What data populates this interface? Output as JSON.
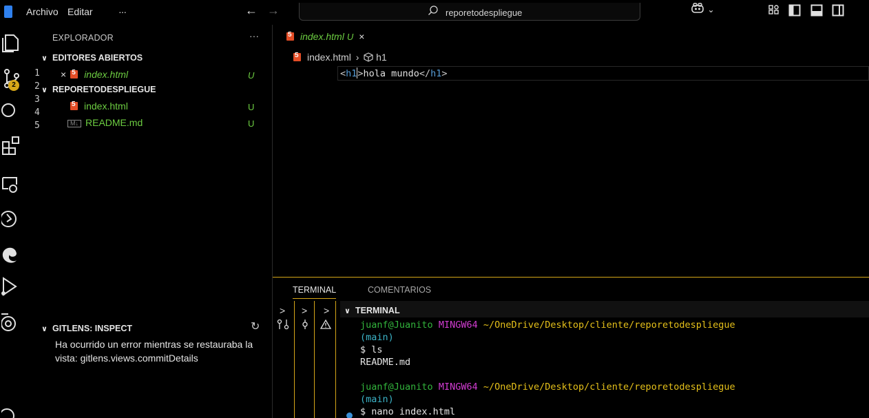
{
  "titlebar": {
    "menu": [
      "Archivo",
      "Editar",
      "···"
    ],
    "back_arrow": "←",
    "forward_arrow": "→",
    "search_text": "reporetodespliegue",
    "copilot_symbol": "⌄"
  },
  "activity": {
    "icons": [
      "explorer-icon",
      "source-control-icon",
      "search-icon",
      "extensions-icon",
      "remote-explorer-icon",
      "timeline-icon",
      "edge-icon",
      "run-debug-icon",
      "gitlens-icon",
      "account-icon"
    ],
    "badge": "2"
  },
  "sidebar": {
    "title": "EXPLORADOR",
    "dots": "···",
    "open_editors": {
      "heading": "EDITORES ABIERTOS",
      "items": [
        {
          "close": "×",
          "name": "index.html",
          "status": "U"
        }
      ]
    },
    "workspace": {
      "heading": "REPORETODESPLIEGUE",
      "files": [
        {
          "icon": "html-icon",
          "name": "index.html",
          "status": "U"
        },
        {
          "icon": "markdown-icon",
          "badge": "M↓",
          "name": "README.md",
          "status": "U"
        }
      ]
    },
    "gitlens": {
      "heading": "GITLENS: INSPECT",
      "refresh": "↻",
      "message": "Ha ocurrido un error mientras se restauraba la vista: gitlens.views.commitDetails"
    }
  },
  "editor": {
    "tab": {
      "name": "index.html",
      "status": "U",
      "close": "×"
    },
    "breadcrumb": {
      "file": "index.html",
      "sep": "›",
      "symbol": "h1"
    },
    "line_numbers": [
      "1",
      "2",
      "3",
      "4",
      "5"
    ],
    "code": {
      "open_lt": "<",
      "open_name": "h1",
      "open_gt": ">",
      "text": "hola mundo",
      "close_lt": "</",
      "close_name": "h1",
      "close_gt": ">"
    }
  },
  "panel": {
    "tabs": [
      "TERMINAL",
      "COMENTARIOS"
    ],
    "terminal_heading": "TERMINAL",
    "side_symbols": [
      ">",
      ">",
      ">"
    ],
    "side_icons": [
      "ȣ̸",
      "ϕ",
      "⚠"
    ],
    "lines": [
      {
        "user": "juanf@Juanito",
        "env": "MINGW64",
        "path": "~/OneDrive/Desktop/cliente/reporetodespliegue",
        "branch": "(main)"
      },
      {
        "cmd": "$ ls"
      },
      {
        "out": "README.md"
      },
      {
        "user": "juanf@Juanito",
        "env": "MINGW64",
        "path": "~/OneDrive/Desktop/cliente/reporetodespliegue",
        "branch": "(main)"
      },
      {
        "cmd": "$ nano index.html"
      }
    ]
  },
  "colors": {
    "accent": "#d7a718",
    "untracked": "#6ccc41",
    "tag": "#569cd6",
    "html_icon": "#e44d26"
  }
}
